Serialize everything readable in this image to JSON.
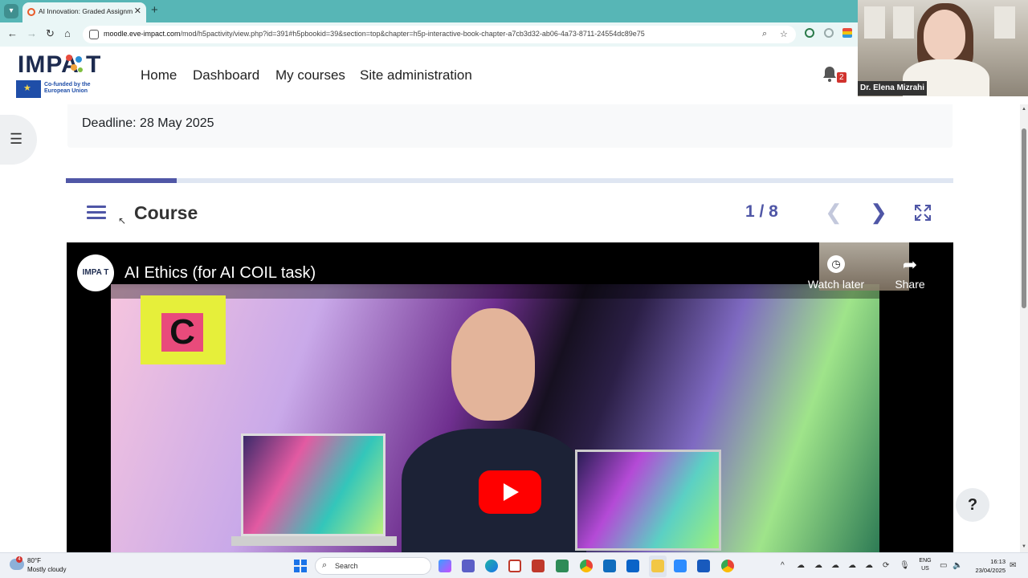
{
  "browser": {
    "tab_title": "AI Innovation: Graded Assignm",
    "url_host": "moodle.eve-impact.com",
    "url_path": "/mod/h5pactivity/view.php?id=391#h5pbookid=39&section=top&chapter=h5p-interactive-book-chapter-a7cb3d32-ab06-4a73-8711-24554dc89e75"
  },
  "site": {
    "logo_text": "IMPA T",
    "funding_text": "Co-funded by the European Union",
    "nav": [
      "Home",
      "Dashboard",
      "My courses",
      "Site administration"
    ],
    "notification_count": "2"
  },
  "webcam": {
    "name": "Dr. Elena Mizrahi"
  },
  "activity": {
    "deadline": "Deadline: 28 May 2025",
    "progress_fraction": 0.125,
    "book_title": "Course",
    "page_indicator": "1 / 8"
  },
  "video": {
    "channel_logo_text": "IMPA T",
    "title": "AI Ethics (for AI COIL task)",
    "watch_later_label": "Watch later",
    "share_label": "Share"
  },
  "taskbar": {
    "weather_badge": "4",
    "temperature": "80°F",
    "condition": "Mostly cloudy",
    "search_label": "Search",
    "lang_top": "ENG",
    "lang_bottom": "US",
    "time": "16:13",
    "date": "23/04/2025"
  },
  "colors": {
    "accent": "#4f56a6",
    "browser_tabbar": "#57b6b6",
    "notification_badge": "#d1332e",
    "youtube_red": "#ff0000"
  }
}
